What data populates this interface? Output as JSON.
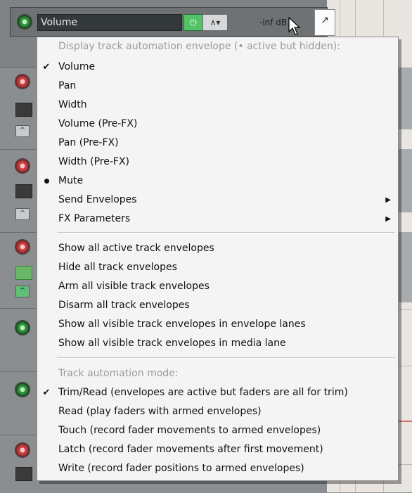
{
  "track": {
    "name": "Volume",
    "power_icon": "power-icon",
    "mode_icon": "automation-mode-icon",
    "volume_readout": "-inf dB",
    "env_toggle_icon": "envelope-icon"
  },
  "menu": {
    "header_display": "Display track automation envelope (• active but hidden):",
    "envelopes": [
      {
        "label": "Volume",
        "mark": "check"
      },
      {
        "label": "Pan",
        "mark": ""
      },
      {
        "label": "Width",
        "mark": ""
      },
      {
        "label": "Volume (Pre-FX)",
        "mark": ""
      },
      {
        "label": "Pan (Pre-FX)",
        "mark": ""
      },
      {
        "label": "Width (Pre-FX)",
        "mark": ""
      },
      {
        "label": "Mute",
        "mark": "bullet"
      },
      {
        "label": "Send Envelopes",
        "mark": "",
        "submenu": true
      },
      {
        "label": "FX Parameters",
        "mark": "",
        "submenu": true
      }
    ],
    "actions": [
      "Show all active track envelopes",
      "Hide all track envelopes",
      "Arm all visible track envelopes",
      "Disarm all track envelopes",
      "Show all visible track envelopes in envelope lanes",
      "Show all visible track envelopes in media lane"
    ],
    "header_mode": "Track automation mode:",
    "modes": [
      {
        "label": "Trim/Read (envelopes are active but faders are all for trim)",
        "mark": "check"
      },
      {
        "label": "Read (play faders with armed envelopes)",
        "mark": ""
      },
      {
        "label": "Touch (record fader movements to armed envelopes)",
        "mark": ""
      },
      {
        "label": "Latch (record fader movements after first movement)",
        "mark": ""
      },
      {
        "label": "Write (record fader positions to armed envelopes)",
        "mark": ""
      }
    ]
  }
}
